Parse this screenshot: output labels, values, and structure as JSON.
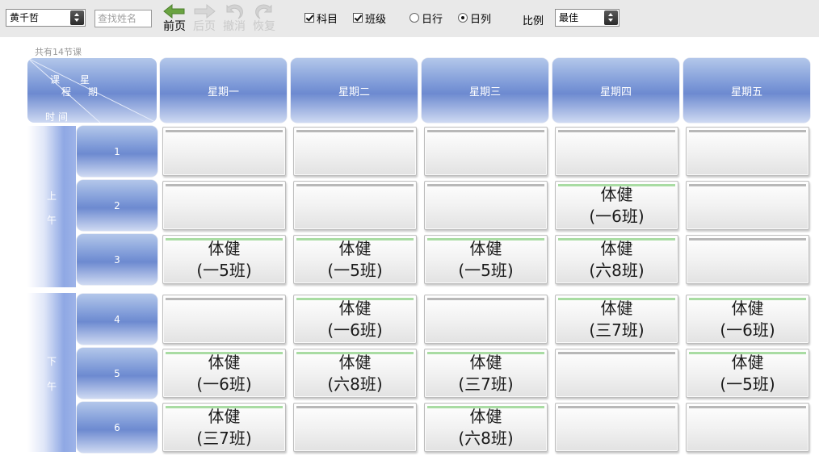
{
  "toolbar": {
    "teacher_select": "黄千哲",
    "search_placeholder": "查找姓名",
    "prev_label": "前页",
    "next_label": "后页",
    "undo_label": "撤消",
    "redo_label": "恢复",
    "subject_label": "科目",
    "subject_checked": true,
    "class_label": "班级",
    "class_checked": true,
    "row_label": "日行",
    "row_selected": false,
    "col_label": "日列",
    "col_selected": true,
    "ratio_label": "比例",
    "ratio_select": "最佳"
  },
  "schedule": {
    "total_lessons": "共有14节课",
    "corner": {
      "lesson": "课",
      "course": "程",
      "week": "星",
      "period": "期",
      "time": "时",
      "between": "间"
    },
    "days": [
      "星期一",
      "星期二",
      "星期三",
      "星期四",
      "星期五"
    ],
    "morning_top": "上",
    "morning_bottom": "午",
    "afternoon_top": "下",
    "afternoon_bottom": "午",
    "lessons": [
      "1",
      "2",
      "3",
      "4",
      "5",
      "6"
    ],
    "cells": [
      [
        {
          "subject": "",
          "class": ""
        },
        {
          "subject": "",
          "class": ""
        },
        {
          "subject": "",
          "class": ""
        },
        {
          "subject": "",
          "class": ""
        },
        {
          "subject": "",
          "class": ""
        }
      ],
      [
        {
          "subject": "",
          "class": ""
        },
        {
          "subject": "",
          "class": ""
        },
        {
          "subject": "",
          "class": ""
        },
        {
          "subject": "体健",
          "class": "(一6班)"
        },
        {
          "subject": "",
          "class": ""
        }
      ],
      [
        {
          "subject": "体健",
          "class": "(一5班)"
        },
        {
          "subject": "体健",
          "class": "(一5班)"
        },
        {
          "subject": "体健",
          "class": "(一5班)"
        },
        {
          "subject": "体健",
          "class": "(六8班)"
        },
        {
          "subject": "",
          "class": ""
        }
      ],
      [
        {
          "subject": "",
          "class": ""
        },
        {
          "subject": "体健",
          "class": "(一6班)"
        },
        {
          "subject": "",
          "class": ""
        },
        {
          "subject": "体健",
          "class": "(三7班)"
        },
        {
          "subject": "体健",
          "class": "(一6班)"
        }
      ],
      [
        {
          "subject": "体健",
          "class": "(一6班)"
        },
        {
          "subject": "体健",
          "class": "(六8班)"
        },
        {
          "subject": "体健",
          "class": "(三7班)"
        },
        {
          "subject": "",
          "class": ""
        },
        {
          "subject": "体健",
          "class": "(一5班)"
        }
      ],
      [
        {
          "subject": "体健",
          "class": "(三7班)"
        },
        {
          "subject": "",
          "class": ""
        },
        {
          "subject": "体健",
          "class": "(六8班)"
        },
        {
          "subject": "",
          "class": ""
        },
        {
          "subject": "",
          "class": ""
        }
      ]
    ]
  },
  "icons": {
    "prev": "left-arrow-icon",
    "next": "right-arrow-icon",
    "undo": "undo-icon",
    "redo": "redo-icon"
  },
  "colors": {
    "header_blue": "#7e9ad8",
    "filled_bar": "#a9dca3",
    "empty_bar": "#b8b8b8",
    "prev_arrow": "#6aa341"
  }
}
